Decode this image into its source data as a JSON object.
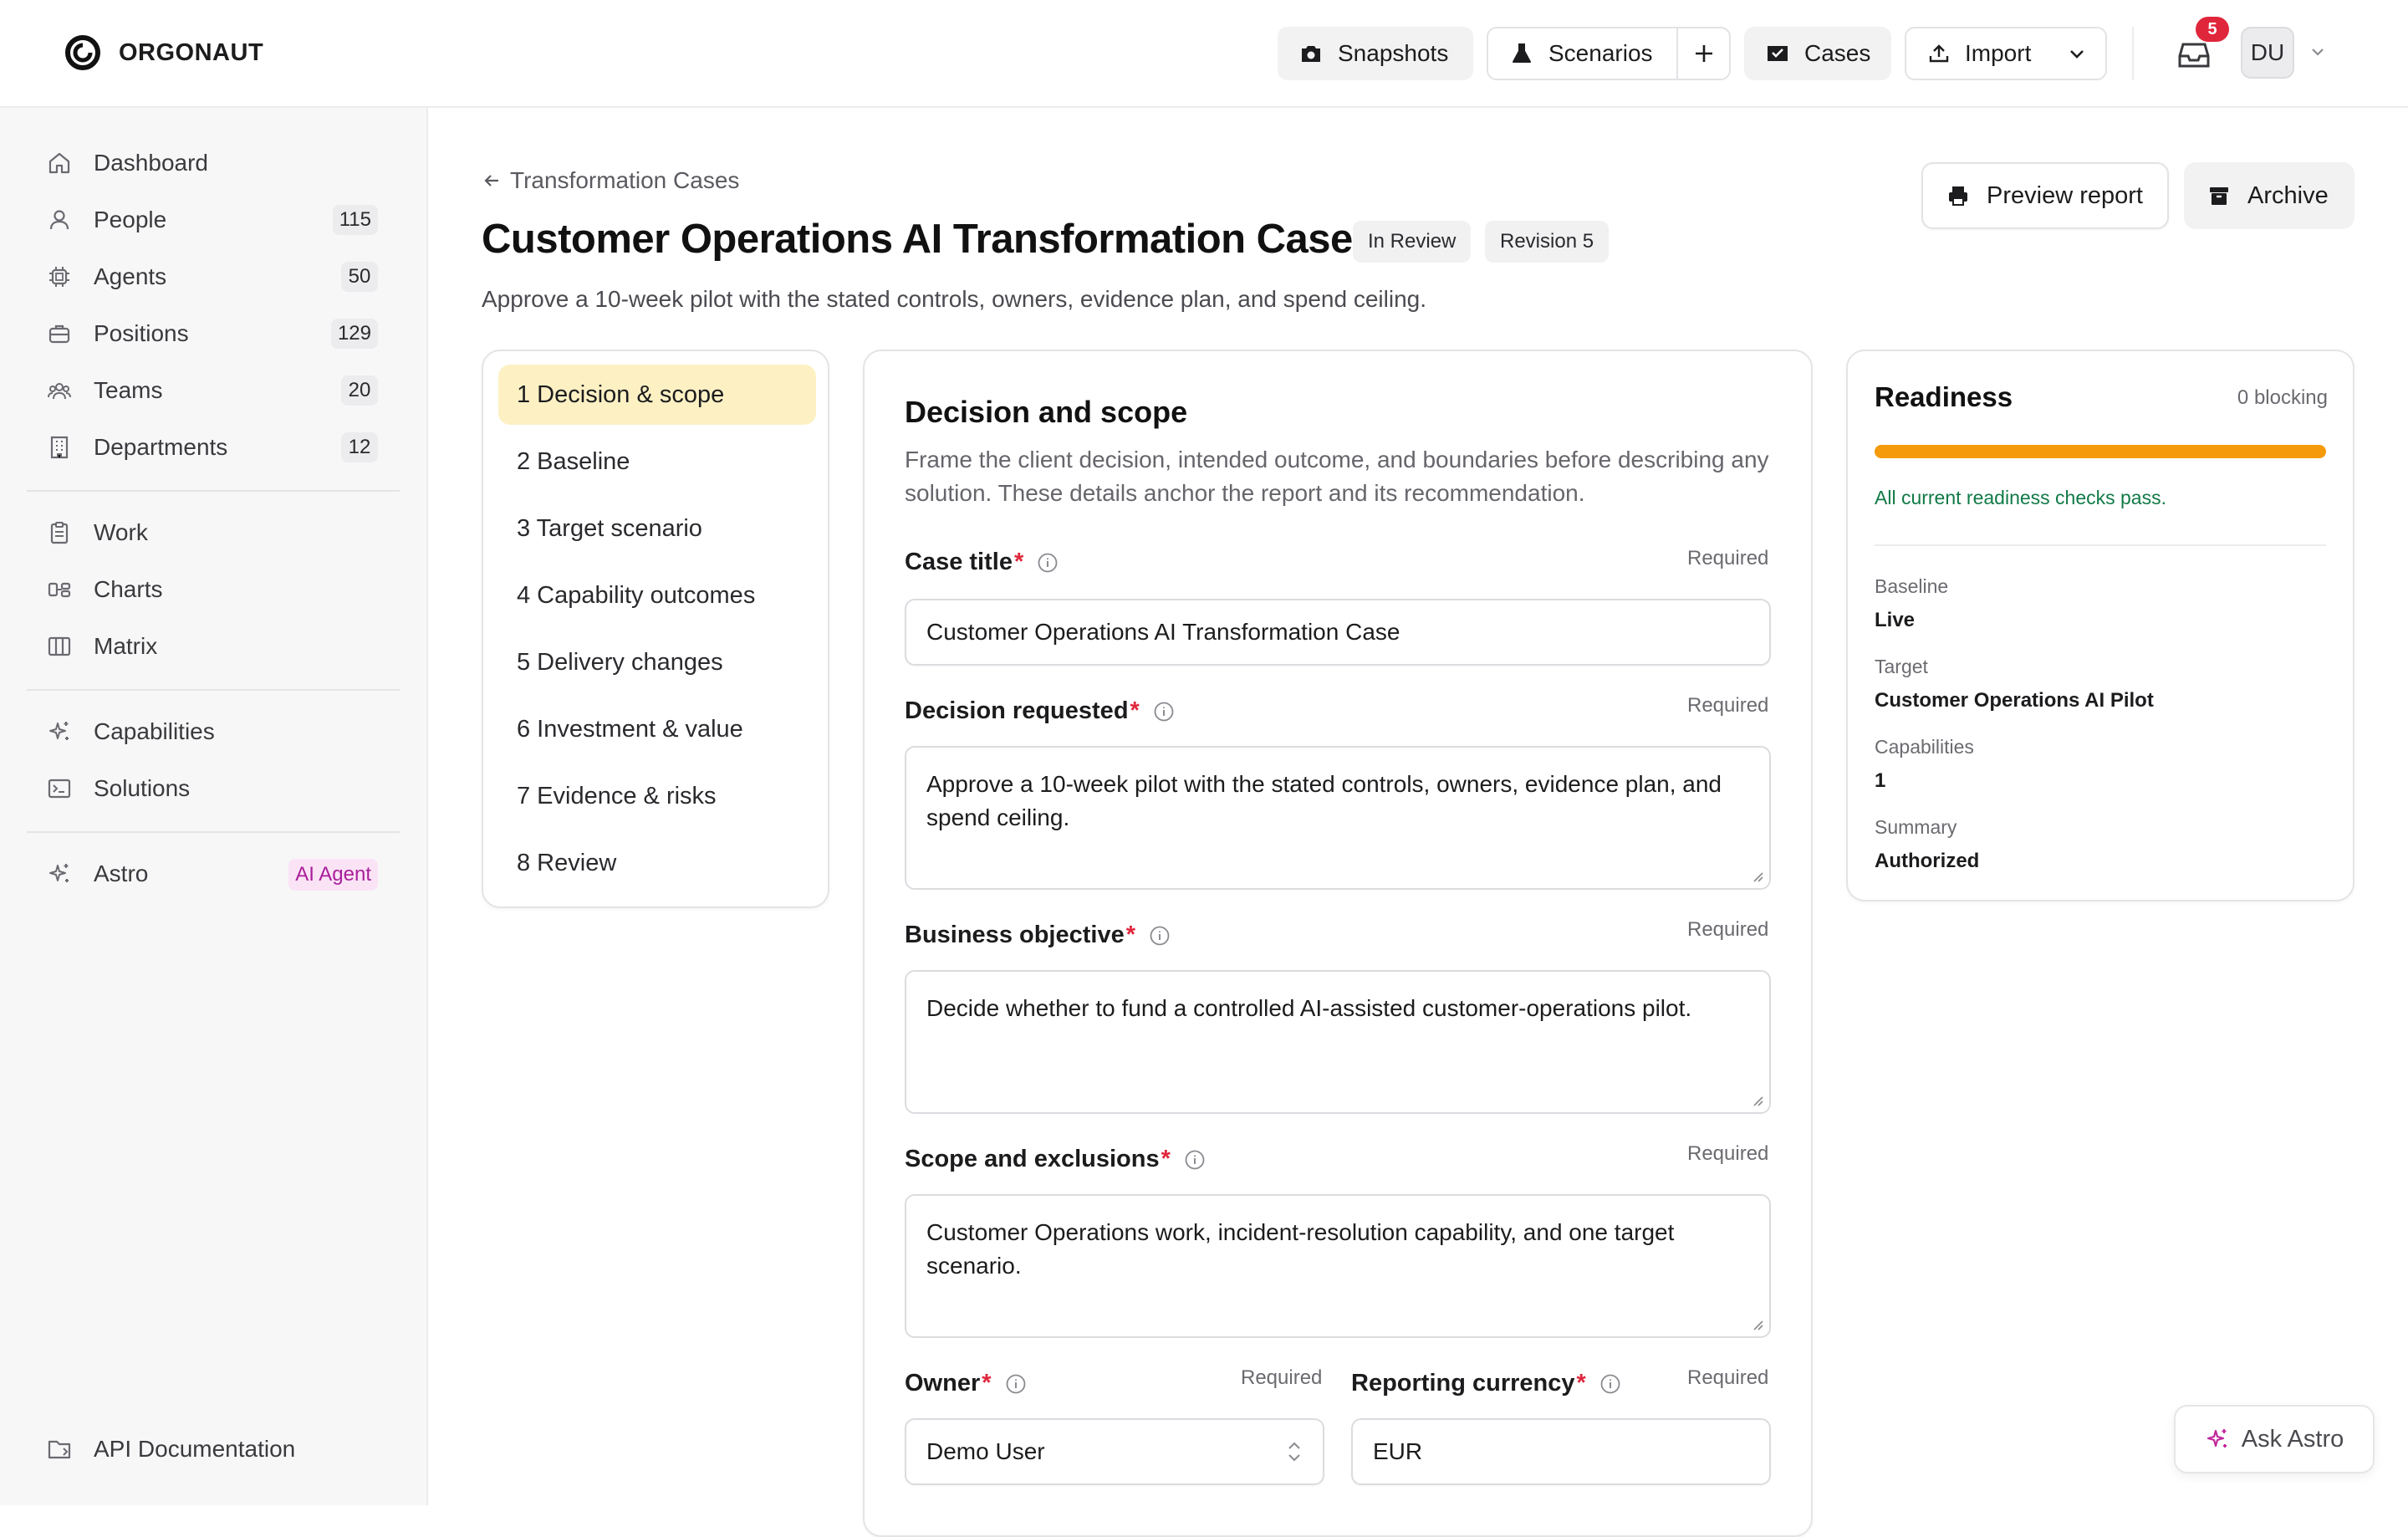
{
  "app": {
    "name": "ORGONAUT"
  },
  "toolbar": {
    "snapshots": "Snapshots",
    "scenarios": "Scenarios",
    "cases": "Cases",
    "import": "Import",
    "notification_count": "5",
    "avatar_initials": "DU"
  },
  "sidebar": {
    "items": [
      {
        "label": "Dashboard",
        "count": ""
      },
      {
        "label": "People",
        "count": "115"
      },
      {
        "label": "Agents",
        "count": "50"
      },
      {
        "label": "Positions",
        "count": "129"
      },
      {
        "label": "Teams",
        "count": "20"
      },
      {
        "label": "Departments",
        "count": "12"
      },
      {
        "label": "Work",
        "count": ""
      },
      {
        "label": "Charts",
        "count": ""
      },
      {
        "label": "Matrix",
        "count": ""
      },
      {
        "label": "Capabilities",
        "count": ""
      },
      {
        "label": "Solutions",
        "count": ""
      },
      {
        "label": "Astro",
        "badge": "AI Agent"
      }
    ],
    "footer": "API Documentation"
  },
  "page": {
    "breadcrumb": "Transformation Cases",
    "title": "Customer Operations AI Transformation Case",
    "status": "In Review",
    "revision": "Revision 5",
    "subtitle": "Approve a 10-week pilot with the stated controls, owners, evidence plan, and spend ceiling.",
    "preview_label": "Preview report",
    "archive_label": "Archive"
  },
  "steps": [
    "1 Decision & scope",
    "2 Baseline",
    "3 Target scenario",
    "4 Capability outcomes",
    "5 Delivery changes",
    "6 Investment & value",
    "7 Evidence & risks",
    "8 Review"
  ],
  "form": {
    "heading": "Decision and scope",
    "description": "Frame the client decision, intended outcome, and boundaries before describing any solution. These details anchor the report and its recommendation.",
    "required": "Required",
    "fields": {
      "case_title": {
        "label": "Case title",
        "value": "Customer Operations AI Transformation Case"
      },
      "decision": {
        "label": "Decision requested",
        "value": "Approve a 10-week pilot with the stated controls, owners, evidence plan, and spend ceiling."
      },
      "objective": {
        "label": "Business objective",
        "value": "Decide whether to fund a controlled AI-assisted customer-operations pilot."
      },
      "scope": {
        "label": "Scope and exclusions",
        "value": "Customer Operations work, incident-resolution capability, and one target scenario."
      },
      "owner": {
        "label": "Owner",
        "value": "Demo User"
      },
      "currency": {
        "label": "Reporting currency",
        "value": "EUR"
      }
    }
  },
  "readiness": {
    "title": "Readiness",
    "blocking": "0 blocking",
    "progress": 1.0,
    "message": "All current readiness checks pass.",
    "baseline_label": "Baseline",
    "baseline_value": "Live",
    "target_label": "Target",
    "target_value": "Customer Operations AI Pilot",
    "capabilities_label": "Capabilities",
    "capabilities_value": "1",
    "summary_label": "Summary",
    "summary_value": "Authorized"
  },
  "assistant": {
    "label": "Ask Astro"
  },
  "colors": {
    "accent": "#f59a0b",
    "active_step": "#fdf1c4",
    "success": "#117a47",
    "required": "#e0263b",
    "badge": "#a81f9a"
  }
}
